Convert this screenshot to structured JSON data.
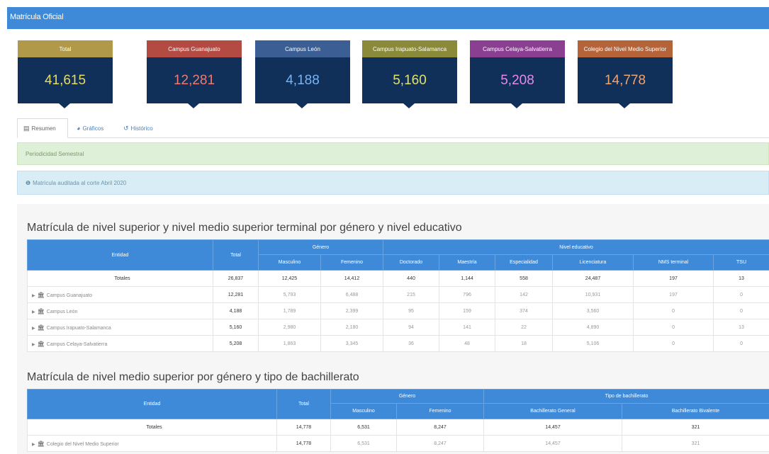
{
  "app": {
    "title": "Matrícula Oficial"
  },
  "kpis": [
    {
      "label": "Total",
      "value": "41,615",
      "head_color": "#b09a4a",
      "value_color": "#e8dd5a"
    },
    {
      "label": "Campus Guanajuato",
      "value": "12,281",
      "head_color": "#b34b43",
      "value_color": "#f07a70"
    },
    {
      "label": "Campus León",
      "value": "4,188",
      "head_color": "#3b5f95",
      "value_color": "#7ab3f0"
    },
    {
      "label": "Campus Irapuato-Salamanca",
      "value": "5,160",
      "head_color": "#8a8a3a",
      "value_color": "#e0e36a"
    },
    {
      "label": "Campus Celaya-Salvatierra",
      "value": "5,208",
      "head_color": "#8a3f91",
      "value_color": "#e58ae8"
    },
    {
      "label": "Colegio del Nivel Medio Superior",
      "value": "14,778",
      "head_color": "#b5643a",
      "value_color": "#f0a46e"
    }
  ],
  "tabs": [
    {
      "label": "Resumen",
      "icon": "document-icon"
    },
    {
      "label": "Gráficos",
      "icon": "pie-chart-icon"
    },
    {
      "label": "Histórico",
      "icon": "history-icon"
    }
  ],
  "alerts": {
    "periodicity": "Periodicidad Semestral",
    "audited": "Matrícula auditada al corte Abril 2020"
  },
  "table1": {
    "title": "Matrícula de nivel superior y nivel medio superior terminal por género y nivel educativo",
    "headers": {
      "entity": "Entidad",
      "total": "Total",
      "gender": "Género",
      "level": "Nivel educativo",
      "male": "Masculino",
      "female": "Femenino",
      "doctorate": "Doctorado",
      "masters": "Maestría",
      "specialty": "Especialidad",
      "bachelor": "Licenciatura",
      "nms_terminal": "NMS terminal",
      "tsu": "TSU"
    },
    "totals": {
      "label": "Totales",
      "cells": [
        "26,837",
        "12,425",
        "14,412",
        "440",
        "1,144",
        "558",
        "24,487",
        "197",
        "13"
      ]
    },
    "rows": [
      {
        "name": "Campus Guanajuato",
        "cells": [
          "12,281",
          "5,793",
          "6,488",
          "215",
          "796",
          "142",
          "10,931",
          "197",
          "0"
        ]
      },
      {
        "name": "Campus León",
        "cells": [
          "4,188",
          "1,789",
          "2,399",
          "95",
          "159",
          "374",
          "3,560",
          "0",
          "0"
        ]
      },
      {
        "name": "Campus Irapuato-Salamanca",
        "cells": [
          "5,160",
          "2,980",
          "2,180",
          "94",
          "141",
          "22",
          "4,890",
          "0",
          "13"
        ]
      },
      {
        "name": "Campus Celaya-Salvatierra",
        "cells": [
          "5,208",
          "1,863",
          "3,345",
          "36",
          "48",
          "18",
          "5,106",
          "0",
          "0"
        ]
      }
    ]
  },
  "table2": {
    "title": "Matrícula de nivel medio superior por género y tipo de bachillerato",
    "headers": {
      "entity": "Entidad",
      "total": "Total",
      "gender": "Género",
      "type": "Tipo de bachillerato",
      "male": "Masculino",
      "female": "Femenino",
      "general": "Bachillerato General",
      "bivalent": "Bachillerato Bivalente"
    },
    "totals": {
      "label": "Totales",
      "cells": [
        "14,778",
        "6,531",
        "8,247",
        "14,457",
        "321"
      ]
    },
    "rows": [
      {
        "name": "Colegio del Nivel Medio Superior",
        "cells": [
          "14,778",
          "6,531",
          "8,247",
          "14,457",
          "321"
        ]
      }
    ]
  }
}
